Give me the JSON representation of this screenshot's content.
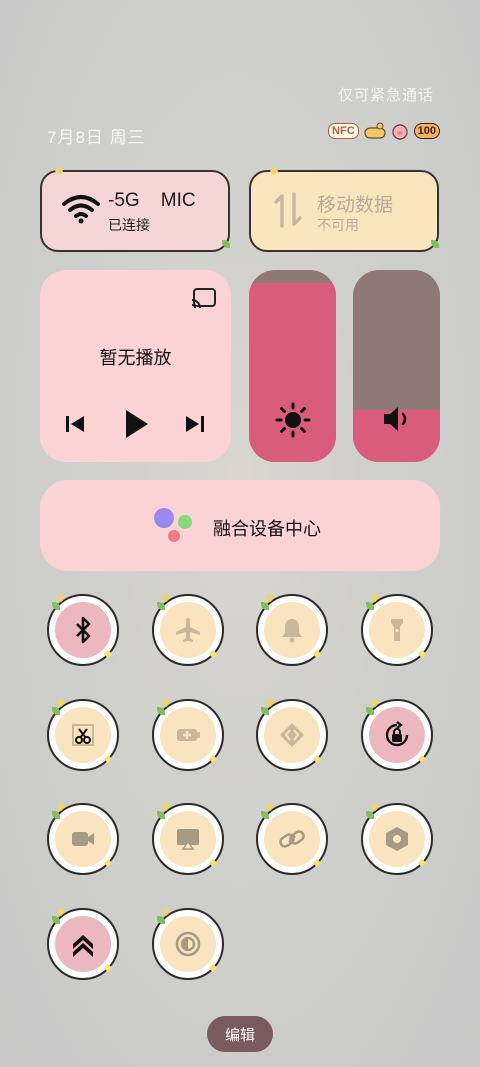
{
  "status": {
    "emergency_text": "仅可紧急通话",
    "date_text": "7月8日 周三",
    "nfc_label": "NFC",
    "battery_level": "100"
  },
  "tiles": {
    "wifi": {
      "title": "-5G    MIC",
      "subtitle": "已连接"
    },
    "mobile": {
      "title": "移动数据",
      "subtitle": "不可用"
    }
  },
  "media": {
    "status": "暂无播放"
  },
  "sliders": {
    "brightness_level": 0.93,
    "volume_level": 0.27
  },
  "fusion": {
    "label": "融合设备中心"
  },
  "quick_settings": [
    {
      "name": "bluetooth",
      "state": "on"
    },
    {
      "name": "airplane",
      "state": "off"
    },
    {
      "name": "bell",
      "state": "off"
    },
    {
      "name": "flashlight",
      "state": "off"
    },
    {
      "name": "screenshot",
      "state": "off"
    },
    {
      "name": "battery-saver",
      "state": "off"
    },
    {
      "name": "share",
      "state": "off"
    },
    {
      "name": "rotation-lock",
      "state": "on"
    },
    {
      "name": "screen-record",
      "state": "off"
    },
    {
      "name": "screen-cast",
      "state": "off"
    },
    {
      "name": "link",
      "state": "off"
    },
    {
      "name": "hexagon-settings",
      "state": "off"
    },
    {
      "name": "double-chevron-up",
      "state": "on"
    },
    {
      "name": "dark-mode",
      "state": "off"
    }
  ],
  "edit": {
    "label": "编辑"
  },
  "colors": {
    "pink": "#f6d5d7",
    "cream": "#f9e6bf",
    "accent": "#d95c7c",
    "slider_bg": "#8e7878"
  }
}
